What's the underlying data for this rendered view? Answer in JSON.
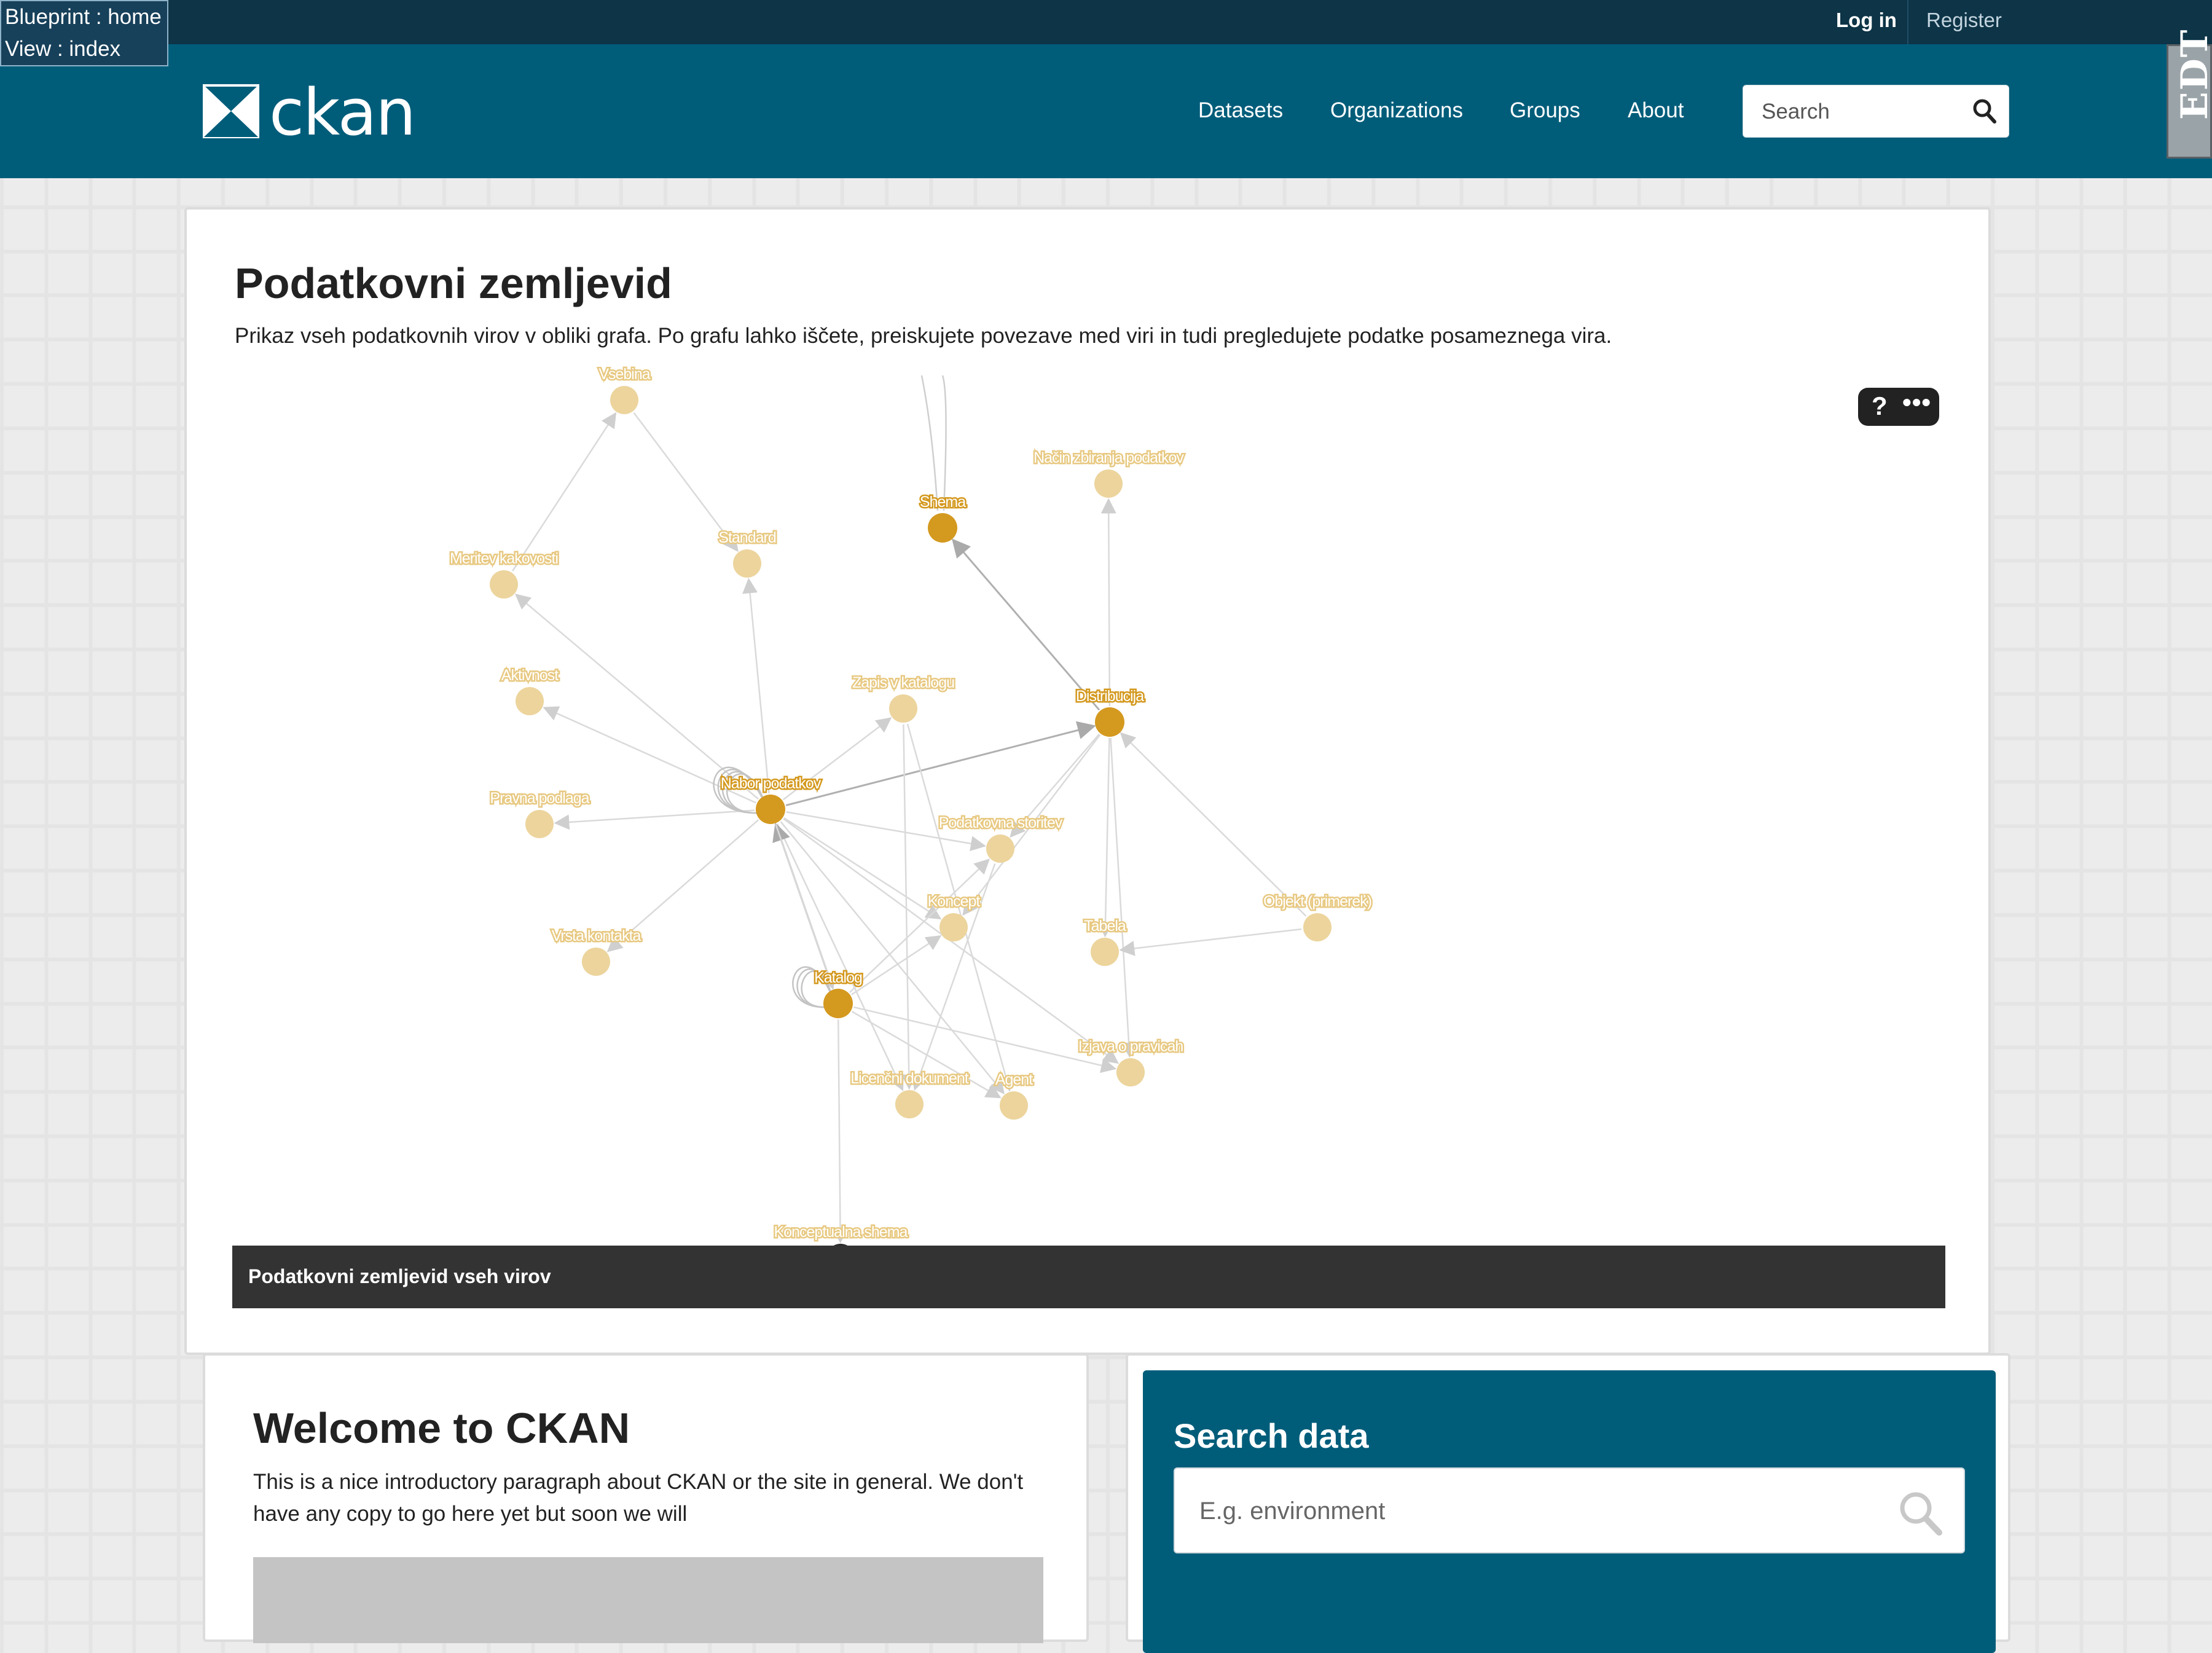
{
  "debug": {
    "blueprint": "Blueprint : home",
    "view": "View : index"
  },
  "account": {
    "login": "Log in",
    "register": "Register"
  },
  "brand": {
    "logo_text": "ckan"
  },
  "nav": {
    "items": [
      "Datasets",
      "Organizations",
      "Groups",
      "About"
    ]
  },
  "header_search": {
    "placeholder": "Search"
  },
  "badge": {
    "text": "EDT"
  },
  "map": {
    "title": "Podatkovni zemljevid",
    "description": "Prikaz vseh podatkovnih virov v obliki grafa. Po grafu lahko iščete, preiskujete povezave med viri in tudi pregledujete podatke posameznega vira.",
    "caption": "Podatkovni zemljevid vseh virov",
    "controls": {
      "help": "?",
      "more": "•••"
    },
    "node_colors": {
      "primary": "#d4991f",
      "secondary": "#ecd49c",
      "label": "#e8c982",
      "dark": "#2b2b2b"
    },
    "nodes": [
      {
        "id": "top",
        "label": "Vsebina",
        "kind": "secondary"
      },
      {
        "id": "nacin",
        "label": "Način zbiranja podatkov",
        "kind": "secondary"
      },
      {
        "id": "shema",
        "label": "Shema",
        "kind": "primary"
      },
      {
        "id": "standard",
        "label": "Standard",
        "kind": "secondary"
      },
      {
        "id": "meritev",
        "label": "Meritev kakovosti",
        "kind": "secondary"
      },
      {
        "id": "aktivnost",
        "label": "Aktivnost",
        "kind": "secondary"
      },
      {
        "id": "zapis",
        "label": "Zapis v katalogu",
        "kind": "secondary"
      },
      {
        "id": "distribucija",
        "label": "Distribucija",
        "kind": "primary"
      },
      {
        "id": "nabor",
        "label": "Nabor podatkov",
        "kind": "primary"
      },
      {
        "id": "pravna",
        "label": "Pravna podlaga",
        "kind": "secondary"
      },
      {
        "id": "storitev",
        "label": "Podatkovna storitev",
        "kind": "secondary"
      },
      {
        "id": "koncept",
        "label": "Koncept",
        "kind": "secondary"
      },
      {
        "id": "objekt",
        "label": "Objekt (primerek)",
        "kind": "secondary"
      },
      {
        "id": "tabela",
        "label": "Tabela",
        "kind": "secondary"
      },
      {
        "id": "vrsta",
        "label": "Vrsta kontakta",
        "kind": "secondary"
      },
      {
        "id": "katalog",
        "label": "Katalog",
        "kind": "primary"
      },
      {
        "id": "izjava",
        "label": "Izjava o pravicah",
        "kind": "secondary"
      },
      {
        "id": "licencni",
        "label": "Licenčni dokument",
        "kind": "secondary"
      },
      {
        "id": "agent",
        "label": "Agent",
        "kind": "secondary"
      },
      {
        "id": "konceptualna",
        "label": "Konceptualna shema",
        "kind": "dark"
      }
    ],
    "edges": [
      [
        "meritev",
        "top"
      ],
      [
        "top",
        "standard"
      ],
      [
        "nabor",
        "meritev"
      ],
      [
        "nabor",
        "standard"
      ],
      [
        "nabor",
        "aktivnost"
      ],
      [
        "nabor",
        "pravna"
      ],
      [
        "nabor",
        "vrsta"
      ],
      [
        "nabor",
        "zapis"
      ],
      [
        "nabor",
        "distribucija"
      ],
      [
        "nabor",
        "storitev"
      ],
      [
        "nabor",
        "koncept"
      ],
      [
        "nabor",
        "izjava"
      ],
      [
        "nabor",
        "licencni"
      ],
      [
        "nabor",
        "agent"
      ],
      [
        "katalog",
        "nabor"
      ],
      [
        "katalog",
        "koncept"
      ],
      [
        "katalog",
        "izjava"
      ],
      [
        "katalog",
        "agent"
      ],
      [
        "katalog",
        "konceptualna"
      ],
      [
        "katalog",
        "storitev"
      ],
      [
        "distribucija",
        "shema"
      ],
      [
        "distribucija",
        "nacin"
      ],
      [
        "distribucija",
        "tabela"
      ],
      [
        "distribucija",
        "storitev"
      ],
      [
        "distribucija",
        "koncept"
      ],
      [
        "distribucija",
        "izjava"
      ],
      [
        "objekt",
        "distribucija"
      ],
      [
        "objekt",
        "tabela"
      ],
      [
        "zapis",
        "licencni"
      ],
      [
        "zapis",
        "agent"
      ],
      [
        "storitev",
        "licencni"
      ],
      [
        "nabor",
        "katalog"
      ]
    ]
  },
  "welcome": {
    "title": "Welcome to CKAN",
    "text": "This is a nice introductory paragraph about CKAN or the site in general. We don't have any copy to go here yet but soon we will"
  },
  "search_data": {
    "title": "Search data",
    "placeholder": "E.g. environment"
  }
}
